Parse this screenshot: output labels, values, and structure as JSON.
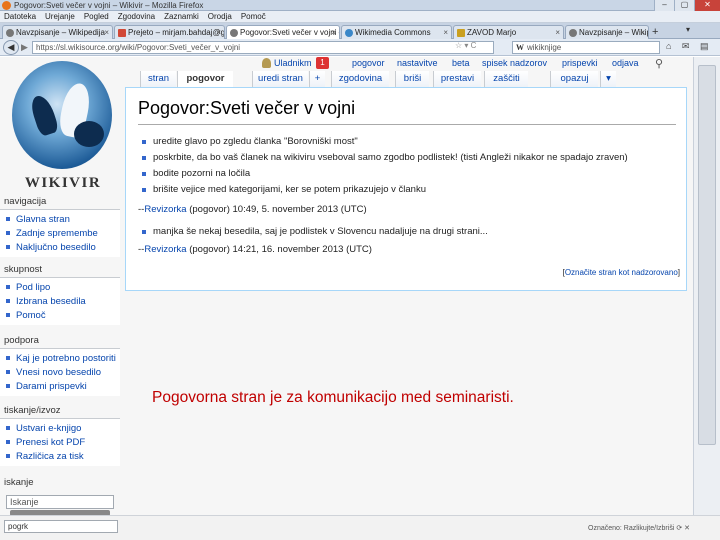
{
  "window": {
    "title": "Pogovor:Sveti večer v vojni – Wikivir – Mozilla Firefox",
    "minimize": "–",
    "maximize": "▢",
    "close": "✕"
  },
  "menu": [
    "Datoteka",
    "Urejanje",
    "Pogled",
    "Zgodovina",
    "Zaznamki",
    "Orodja",
    "Pomoč"
  ],
  "browser_tabs": [
    {
      "label": "Navzpisanje – Wikipedija",
      "icon": "wikipedia-favicon"
    },
    {
      "label": "Prejeto – mirjam.bahdaj@gma…",
      "icon": "gmail-favicon"
    },
    {
      "label": "Pogovor:Sveti večer v vojni – …",
      "icon": "wikivir-favicon",
      "active": true
    },
    {
      "label": "Wikimedia Commons",
      "icon": "commons-favicon"
    },
    {
      "label": "ZAVOD Marjo",
      "icon": "zavod-favicon"
    },
    {
      "label": "Navzpisanje – Wikipedija",
      "icon": "wikipedia-favicon"
    }
  ],
  "tab_close_glyph": "×",
  "new_tab_glyph": "+",
  "tab_list_glyph": "▾",
  "nav": {
    "back_glyph": "◀",
    "forward_glyph": "▶",
    "url": "https://sl.wikisource.org/wiki/Pogovor:Sveti_večer_v_vojni",
    "url_icons": "☆ ▾ C",
    "search_prefix": "W",
    "search_placeholder": "wikiknjige",
    "right_icons": "⌂ ✉ ▤"
  },
  "logo": {
    "name": "WIKIVIR"
  },
  "sidebar": [
    {
      "heading": "navigacija",
      "items": [
        "Glavna stran",
        "Zadnje spremembe",
        "Naključno besedilo"
      ]
    },
    {
      "heading": "skupnost",
      "items": [
        "Pod lipo",
        "Izbrana besedila",
        "Pomoč"
      ]
    },
    {
      "heading": "podpora",
      "items": [
        "Kaj je potrebno postoriti",
        "Vnesi novo besedilo",
        "Darami prispevki"
      ]
    },
    {
      "heading": "tiskanje/izvoz",
      "items": [
        "Ustvari e-knjigo",
        "Prenesi kot PDF",
        "Različica za tisk"
      ]
    },
    {
      "heading": "iskanje",
      "items": []
    }
  ],
  "sidebar_search_placeholder": "Iskanje",
  "content_tabs": [
    {
      "label": "stran",
      "selected": false
    },
    {
      "label": "pogovor",
      "selected": true
    },
    {
      "label": "uredi stran",
      "selected": false
    },
    {
      "label": "+",
      "selected": false
    },
    {
      "label": "zgodovina",
      "selected": false
    },
    {
      "label": "briši",
      "selected": false
    },
    {
      "label": "prestavi",
      "selected": false
    },
    {
      "label": "zaščiti",
      "selected": false
    },
    {
      "label": "opazuj",
      "selected": false
    },
    {
      "label": "▾",
      "selected": false
    }
  ],
  "personal": {
    "username": "Uladnikm",
    "notifications": "1",
    "links": [
      "pogovor",
      "nastavitve",
      "beta",
      "spisek nadzorov",
      "prispevki",
      "odjava"
    ],
    "search_glyph": "⚲"
  },
  "page": {
    "title": "Pogovor:Sveti večer v vojni",
    "bullets1": [
      "uredite glavo po zgledu članka \"Borovniški most\"",
      "poskrbite, da bo vaš članek na wikiviru vseboval samo zgodbo podlistek! (tisti Angleži nikakor ne spadajo zraven)",
      "bodite pozorni na ločila",
      "brišite vejice med kategorijami, ker se potem prikazujejo v članku"
    ],
    "sig1": {
      "prefix": "--",
      "user": "Revizorka",
      "rest": " (pogovor) 10:49, 5. november 2013 (UTC)"
    },
    "bullets2": [
      "manjka še nekaj besedila, saj je podlistek v Slovencu nadaljuje na drugi strani..."
    ],
    "sig2": {
      "prefix": "--",
      "user": "Revizorka",
      "rest": " (pogovor) 14:21, 16. november 2013 (UTC)"
    },
    "watch": {
      "open": "[",
      "link": "Označite stran kot nadzorovano",
      "close": "]"
    }
  },
  "annotation": "Pogovorna stran je za komunikacijo med seminaristi.",
  "status": {
    "find_value": "pogrk",
    "right": "Označeno: Razlikujte/Izbriši ⟳ ✕"
  },
  "colors": {
    "link": "#0645ad",
    "annotation": "#c00000",
    "notification": "#dd3333"
  }
}
